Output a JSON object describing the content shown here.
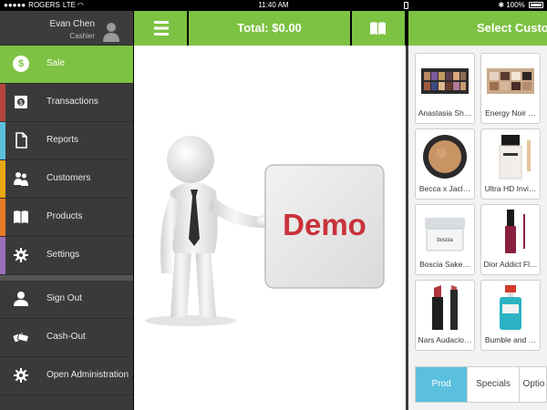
{
  "status_bar": {
    "carrier": "ROGERS",
    "network": "LTE",
    "time": "11:40 AM",
    "battery": "100%"
  },
  "profile": {
    "name": "Evan Chen",
    "role": "Cashier"
  },
  "nav": {
    "items": [
      {
        "label": "Sale",
        "icon": "dollar-icon",
        "stripe": "#7dc242",
        "active": true
      },
      {
        "label": "Transactions",
        "icon": "cash-register-icon",
        "stripe": "#b5473f"
      },
      {
        "label": "Reports",
        "icon": "document-icon",
        "stripe": "#5bc0de"
      },
      {
        "label": "Customers",
        "icon": "people-icon",
        "stripe": "#e8a712"
      },
      {
        "label": "Products",
        "icon": "book-icon",
        "stripe": "#e87a25"
      },
      {
        "label": "Settings",
        "icon": "gear-icon",
        "stripe": "#9b6fb8"
      }
    ],
    "secondary": [
      {
        "label": "Sign Out",
        "icon": "user-icon"
      },
      {
        "label": "Cash-Out",
        "icon": "money-icon"
      },
      {
        "label": "Open Administration",
        "icon": "gear-icon"
      }
    ]
  },
  "header": {
    "menu_icon": "hamburger-icon",
    "total": "Total: $0.00",
    "catalog_icon": "book-icon",
    "select_customer": "Select Customer"
  },
  "demo": {
    "text": "Demo"
  },
  "products": [
    {
      "label": "Anastasia Sh…",
      "icon": "eyeshadow-palette-icon"
    },
    {
      "label": "Energy Noir …",
      "icon": "eyeshadow-palette-icon"
    },
    {
      "label": "Becca x Jacl…",
      "icon": "compact-powder-icon"
    },
    {
      "label": "Ultra HD Invi…",
      "icon": "foundation-bottle-icon"
    },
    {
      "label": "Boscia Sake…",
      "icon": "cream-jar-icon"
    },
    {
      "label": "Dior Addict Fl…",
      "icon": "lip-gloss-icon"
    },
    {
      "label": "Nars Audacio…",
      "icon": "lipstick-icon"
    },
    {
      "label": "Bumble and …",
      "icon": "spray-bottle-icon"
    }
  ],
  "tabs": [
    {
      "label": "Prod",
      "active": true
    },
    {
      "label": "Specials"
    },
    {
      "label": "Optio"
    }
  ],
  "colors": {
    "accent": "#7dc242",
    "sidebar": "#3a3a3a",
    "tab_active": "#5bc0de"
  }
}
